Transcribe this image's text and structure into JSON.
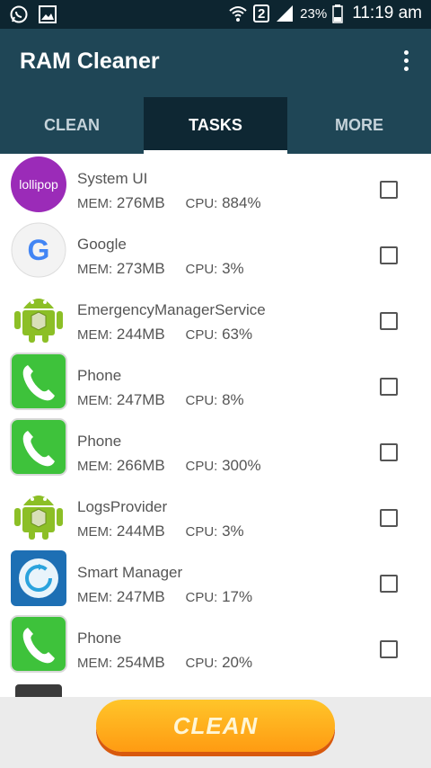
{
  "status_bar": {
    "sim_slot": "2",
    "battery": "23%",
    "time": "11:19 am",
    "icons": [
      "whatsapp-icon",
      "gallery-icon",
      "wifi-icon",
      "signal-icon",
      "battery-icon"
    ]
  },
  "app_bar": {
    "title": "RAM Cleaner",
    "menu_icon": "more-vert-icon"
  },
  "tabs": [
    {
      "label": "CLEAN",
      "active": false
    },
    {
      "label": "TASKS",
      "active": true
    },
    {
      "label": "MORE",
      "active": false
    }
  ],
  "labels": {
    "mem": "MEM:",
    "cpu": "CPU:"
  },
  "tasks": [
    {
      "name": "System UI",
      "mem": "276MB",
      "cpu": "884%",
      "icon": "lollipop-icon",
      "icon_text": "lollipop",
      "checked": false
    },
    {
      "name": "Google",
      "mem": "273MB",
      "cpu": "3%",
      "icon": "google-icon",
      "icon_text": "G",
      "checked": false
    },
    {
      "name": "EmergencyManagerService",
      "mem": "244MB",
      "cpu": "63%",
      "icon": "android-icon",
      "checked": false
    },
    {
      "name": "Phone",
      "mem": "247MB",
      "cpu": "8%",
      "icon": "phone-icon",
      "checked": false
    },
    {
      "name": "Phone",
      "mem": "266MB",
      "cpu": "300%",
      "icon": "phone-icon",
      "checked": false
    },
    {
      "name": "LogsProvider",
      "mem": "244MB",
      "cpu": "3%",
      "icon": "android-icon",
      "checked": false
    },
    {
      "name": "Smart Manager",
      "mem": "247MB",
      "cpu": "17%",
      "icon": "smart-manager-icon",
      "checked": false
    },
    {
      "name": "Phone",
      "mem": "254MB",
      "cpu": "20%",
      "icon": "phone-icon",
      "checked": false
    }
  ],
  "bottom": {
    "clean_label": "CLEAN"
  },
  "colors": {
    "status_bar": "#0d2530",
    "app_bar": "#1f4656",
    "active_tab": "#0e2733",
    "button_top": "#ffc52a",
    "button_bottom": "#ff9b12"
  }
}
